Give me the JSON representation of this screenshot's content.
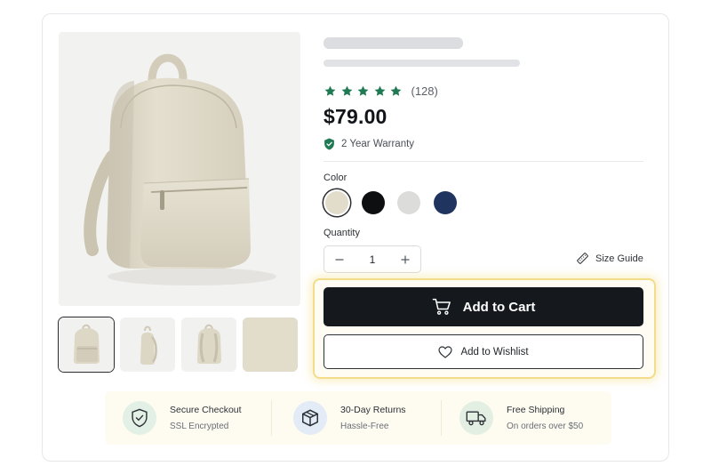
{
  "product": {
    "rating": {
      "stars": 5,
      "review_count": "(128)",
      "color": "#1f7a54"
    },
    "price": "$79.00",
    "warranty": "2 Year Warranty",
    "color_label": "Color",
    "colors": [
      {
        "name": "beige",
        "hex": "#e2dccb",
        "selected": true
      },
      {
        "name": "black",
        "hex": "#0e0f11",
        "selected": false
      },
      {
        "name": "light-gray",
        "hex": "#dcdcda",
        "selected": false
      },
      {
        "name": "navy",
        "hex": "#1f3560",
        "selected": false
      }
    ],
    "quantity_label": "Quantity",
    "quantity": "1",
    "size_guide": "Size Guide",
    "add_to_cart": "Add to Cart",
    "add_to_wishlist": "Add to Wishlist"
  },
  "gallery": {
    "main_image": "beige-backpack",
    "thumbnails": [
      "backpack-front",
      "backpack-side",
      "backpack-back",
      "fabric-swatch"
    ],
    "active_thumbnail": 0
  },
  "features": [
    {
      "title": "Secure Checkout",
      "subtitle": "SSL Encrypted",
      "icon": "shield-check-icon",
      "bg": "#e3f0e5"
    },
    {
      "title": "30-Day Returns",
      "subtitle": "Hassle-Free",
      "icon": "box-icon",
      "bg": "#e2ebf6"
    },
    {
      "title": "Free Shipping",
      "subtitle": "On orders over $50",
      "icon": "truck-icon",
      "bg": "#e3efe3"
    }
  ]
}
